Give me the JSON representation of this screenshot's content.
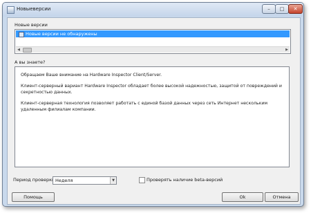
{
  "window": {
    "title": "Новыеверсии"
  },
  "versions": {
    "label": "Новые версии",
    "items": [
      "Новые версии не обнаружены"
    ]
  },
  "tips": {
    "label": "А вы знаете?",
    "paragraphs": [
      "Обращаем Ваше внимание на Hardware Inspector Client/Server.",
      "Клиент-серверный вариант Hardware Inspector обладает более высокой надежностью, защитой от повреждений и секретностью данных.",
      "Клиент-серверная технология позволяет работать с единой базой данных через сеть Интернет нескольким удаленным филиалам компании."
    ]
  },
  "check": {
    "period_label": "Период проверки",
    "period_value": "Неделя",
    "beta_label": "Проверять наличие beta-версий",
    "beta_checked": false
  },
  "buttons": {
    "help": "Помощь",
    "ok": "Ok",
    "cancel": "Отмена"
  },
  "icons": {
    "title": "app-window-icon",
    "min": "minimize-icon",
    "max": "maximize-icon",
    "close": "close-icon",
    "item": "version-item-icon"
  }
}
